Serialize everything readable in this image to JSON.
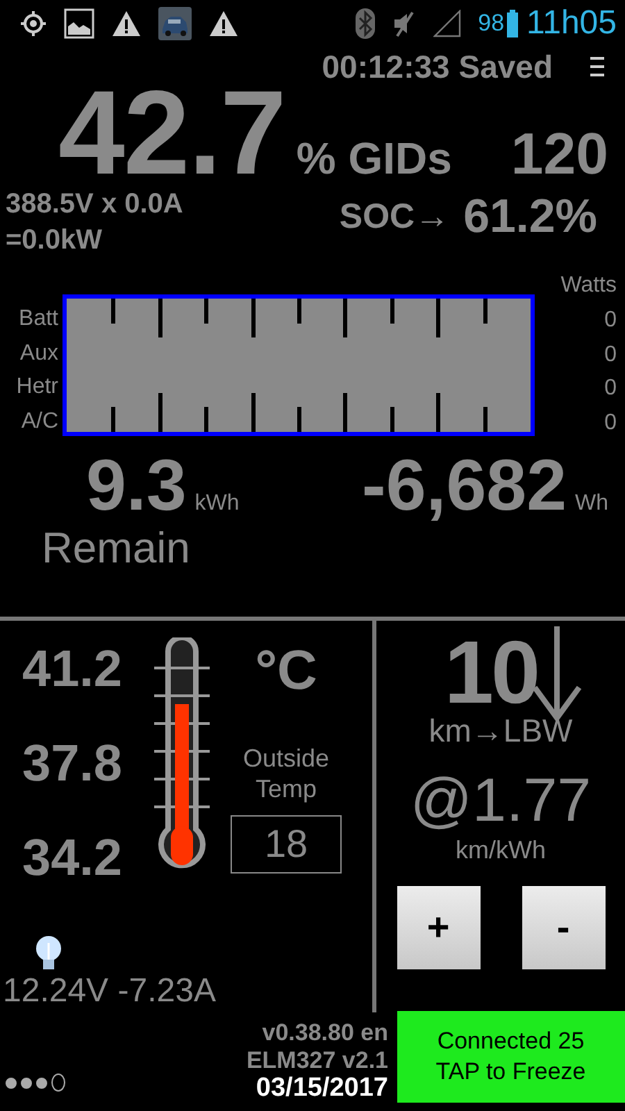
{
  "status_bar": {
    "battery_percent": "98",
    "time": "11h05"
  },
  "header": {
    "timer": "00:12:33 Saved"
  },
  "gids": {
    "percent": "42.7",
    "unit": "% GIDs",
    "count": "120"
  },
  "power": {
    "line_1": "388.5V x 0.0A",
    "line_2": "=0.0kW",
    "soc_label": "SOC→",
    "soc_value": "61.2%"
  },
  "meter": {
    "header": "Watts",
    "rows": [
      {
        "label": "Batt",
        "watts": "0"
      },
      {
        "label": "Aux",
        "watts": "0"
      },
      {
        "label": "Hetr",
        "watts": "0"
      },
      {
        "label": "A/C",
        "watts": "0"
      }
    ]
  },
  "energy": {
    "remain_value": "9.3",
    "remain_unit": "kWh",
    "remain_label": "Remain",
    "used_value": "-6,682",
    "used_unit": "Wh"
  },
  "battery_temp": {
    "readings": [
      "41.2",
      "37.8",
      "34.2"
    ],
    "unit": "°C",
    "outside_label": "Outside Temp",
    "outside_value": "18"
  },
  "aux_battery": {
    "reading": "12.24V -7.23A"
  },
  "range": {
    "value": "10",
    "unit": "km→LBW",
    "efficiency": "@1.77",
    "efficiency_unit": "km/kWh",
    "buttons": [
      "+",
      "-"
    ]
  },
  "footer": {
    "pages": [
      {
        "filled": true
      },
      {
        "filled": true
      },
      {
        "filled": true
      },
      {
        "filled": false
      }
    ],
    "version": "v0.38.80 en",
    "adapter": "ELM327 v2.1",
    "date": "03/15/2017"
  },
  "connection": {
    "lines": [
      "Connected 25",
      "TAP to Freeze"
    ]
  }
}
